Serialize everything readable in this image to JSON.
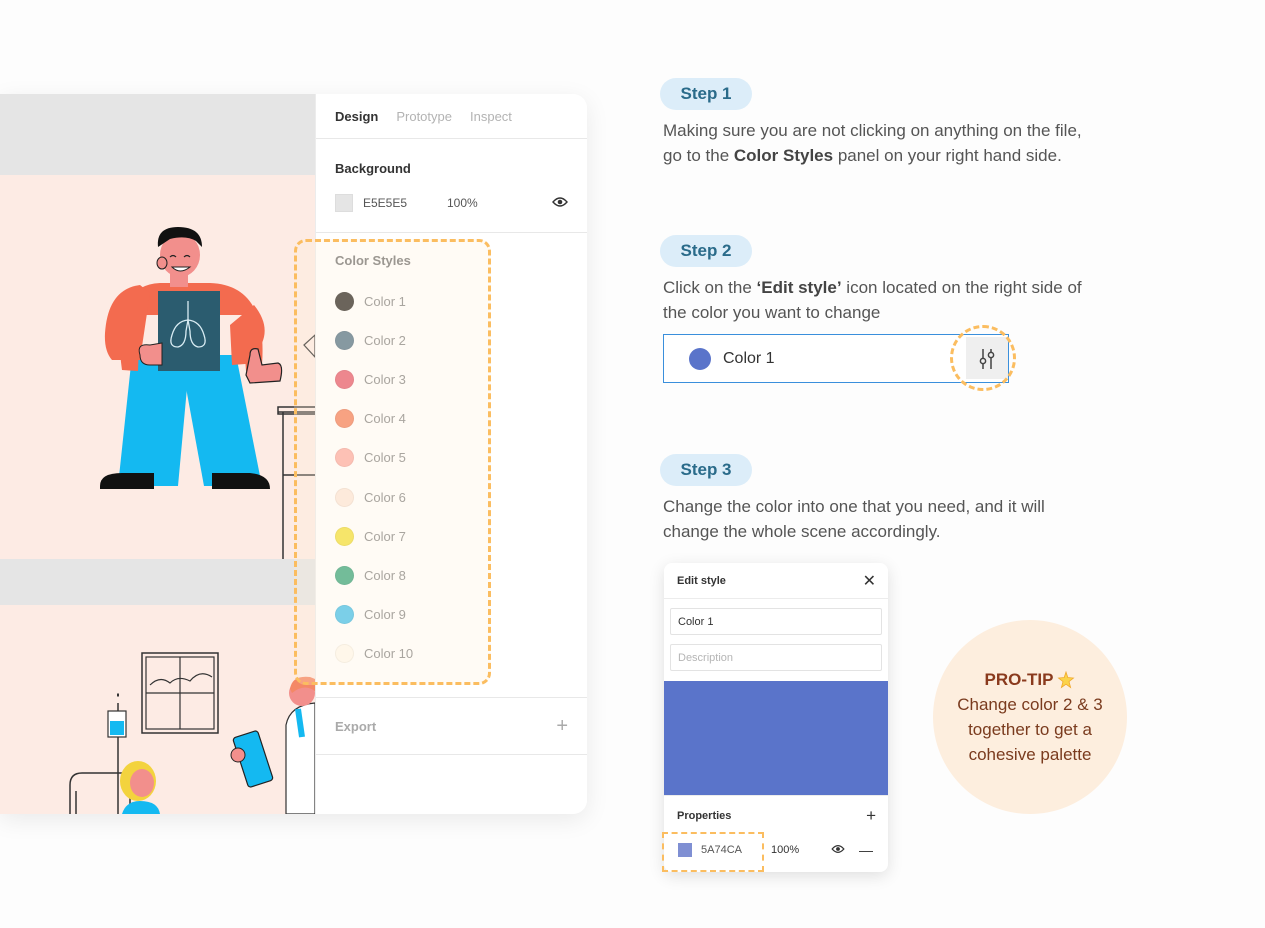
{
  "panel": {
    "tabs": [
      {
        "label": "Design",
        "active": true
      },
      {
        "label": "Prototype",
        "active": false
      },
      {
        "label": "Inspect",
        "active": false
      }
    ],
    "background": {
      "title": "Background",
      "hex": "E5E5E5",
      "opacity": "100%",
      "color": "#e5e5e5"
    },
    "color_styles": {
      "title": "Color Styles",
      "items": [
        {
          "label": "Color 1",
          "color": "#3a3632"
        },
        {
          "label": "Color 2",
          "color": "#5e7c8f"
        },
        {
          "label": "Color 3",
          "color": "#e76576"
        },
        {
          "label": "Color 4",
          "color": "#f48866"
        },
        {
          "label": "Color 5",
          "color": "#fdb2aa"
        },
        {
          "label": "Color 6",
          "color": "#fde9dd"
        },
        {
          "label": "Color 7",
          "color": "#f3e246"
        },
        {
          "label": "Color 8",
          "color": "#45ab85"
        },
        {
          "label": "Color 9",
          "color": "#4fc5ee"
        },
        {
          "label": "Color 10",
          "color": "#fffaf0"
        }
      ]
    },
    "export": {
      "title": "Export"
    }
  },
  "steps": [
    {
      "label": "Step 1"
    },
    {
      "label": "Step 2"
    },
    {
      "label": "Step 3"
    }
  ],
  "step1_text": {
    "pre": "Making sure you are not clicking on anything on the file, go to the ",
    "bold": "Color Styles",
    "post": " panel on your right hand side."
  },
  "step2_text": {
    "pre": "Click on the ",
    "bold": "‘Edit style’",
    "post": " icon located on the right side of the color you want to change"
  },
  "step3_text": "Change the color into one that you need, and it will change the whole scene accordingly.",
  "color_row": {
    "label": "Color 1",
    "color": "#5a74ca"
  },
  "edit_style": {
    "title": "Edit style",
    "name_value": "Color 1",
    "description_placeholder": "Description",
    "preview_color": "#5a74ca",
    "properties_title": "Properties",
    "hex": "5A74CA",
    "opacity": "100%"
  },
  "protip": {
    "title": "PRO-TIP",
    "body": "Change color 2 & 3 together to get a cohesive palette"
  },
  "colors": {
    "accent_dash": "#fbbd60",
    "step_pill_bg": "#dcedf9",
    "step_pill_text": "#2a6b8a",
    "selection_border": "#3a8fdc"
  }
}
